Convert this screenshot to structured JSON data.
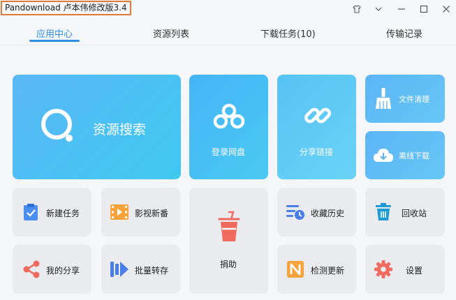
{
  "window": {
    "title": "Pandownload 卢本伟修改版3.4",
    "controls": [
      "shirt-icon",
      "chevron-down-icon",
      "minimize-icon",
      "maximize-icon",
      "close-icon"
    ]
  },
  "tabs": [
    {
      "label": "应用中心",
      "active": true
    },
    {
      "label": "资源列表",
      "active": false
    },
    {
      "label": "下载任务(10)",
      "active": false
    },
    {
      "label": "传输记录",
      "active": false
    }
  ],
  "tiles": {
    "resource_search": "资源搜索",
    "login_pan": "登录网盘",
    "share_link": "分享链接",
    "file_clean": "文件清理",
    "offline_download": "离线下载",
    "new_task": "新建任务",
    "movies": "影视新番",
    "donate": "捐助",
    "favorites_history": "收藏历史",
    "recycle_bin": "回收站",
    "my_share": "我的分享",
    "batch_transfer": "批量转存",
    "check_update": "检测更新",
    "settings": "设置"
  },
  "colors": {
    "accent": "#2d8ee6",
    "tile_blue": "#4fc0f4",
    "tile_grey": "#e9ebef",
    "donate_red": "#f16a5f"
  }
}
